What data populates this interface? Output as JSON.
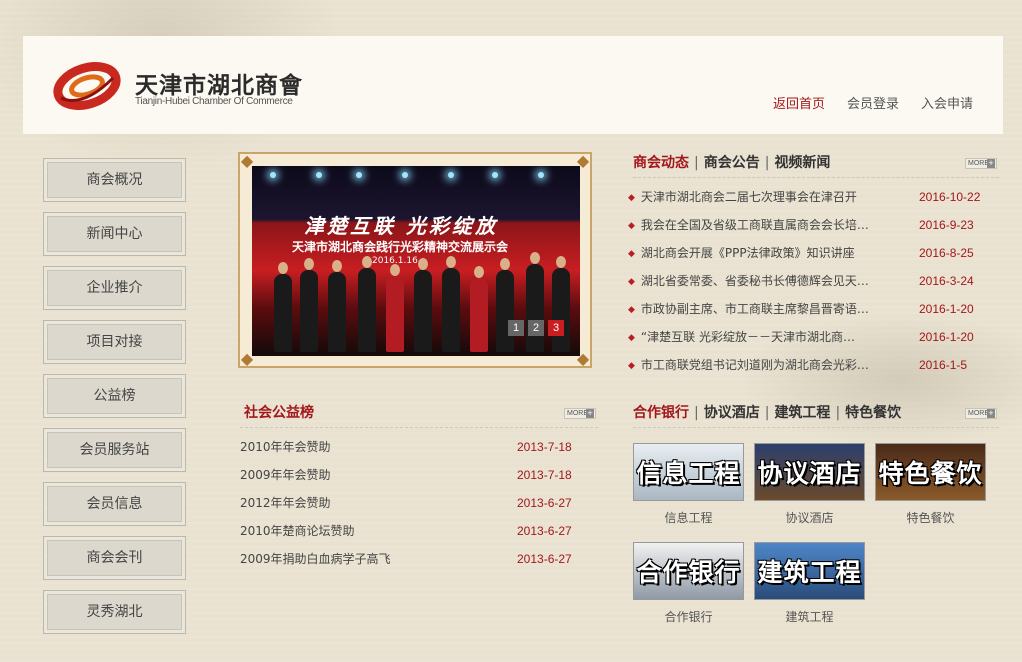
{
  "header": {
    "logo_cn": "天津市湖北商會",
    "logo_en": "Tianjin-Hubei Chamber Of Commerce",
    "nav": [
      {
        "label": "返回首页",
        "active": true
      },
      {
        "label": "会员登录",
        "active": false
      },
      {
        "label": "入会申请",
        "active": false
      }
    ]
  },
  "sidebar": {
    "items": [
      {
        "label": "商会概况"
      },
      {
        "label": "新闻中心"
      },
      {
        "label": "企业推介"
      },
      {
        "label": "项目对接"
      },
      {
        "label": "公益榜"
      },
      {
        "label": "会员服务站"
      },
      {
        "label": "会员信息"
      },
      {
        "label": "商会会刊"
      },
      {
        "label": "灵秀湖北"
      }
    ]
  },
  "slider": {
    "banner_line1": "津楚互联  光彩绽放",
    "banner_line2": "天津市湖北商会践行光彩精神交流展示会",
    "banner_line3": "2016.1.16",
    "pages": [
      "1",
      "2",
      "3"
    ],
    "active_page": "3"
  },
  "news": {
    "tabs": [
      "商会动态",
      "商会公告",
      "视频新闻"
    ],
    "more": "MORE",
    "items": [
      {
        "title": "天津市湖北商会二届七次理事会在津召开",
        "date": "2016-10-22"
      },
      {
        "title": "我会在全国及省级工商联直属商会会长培…",
        "date": "2016-9-23"
      },
      {
        "title": "湖北商会开展《PPP法律政策》知识讲座",
        "date": "2016-8-25"
      },
      {
        "title": "湖北省委常委、省委秘书长傅德辉会见天…",
        "date": "2016-3-24"
      },
      {
        "title": "市政协副主席、市工商联主席黎昌晋寄语…",
        "date": "2016-1-20"
      },
      {
        "title": "“津楚互联 光彩绽放－－天津市湖北商…",
        "date": "2016-1-20"
      },
      {
        "title": "市工商联党组书记刘道刚为湖北商会光彩…",
        "date": "2016-1-5"
      }
    ]
  },
  "welfare": {
    "title": "社会公益榜",
    "more": "MORE",
    "items": [
      {
        "title": "2010年年会赞助",
        "date": "2013-7-18"
      },
      {
        "title": "2009年年会赞助",
        "date": "2013-7-18"
      },
      {
        "title": "2012年年会赞助",
        "date": "2013-6-27"
      },
      {
        "title": "2010年楚商论坛赞助",
        "date": "2013-6-27"
      },
      {
        "title": "2009年捐助白血病学子高飞",
        "date": "2013-6-27"
      }
    ]
  },
  "coop": {
    "tabs": [
      "合作银行",
      "协议酒店",
      "建筑工程",
      "特色餐饮"
    ],
    "more": "MORE",
    "tiles": [
      {
        "image_text": "信息工程",
        "caption": "信息工程"
      },
      {
        "image_text": "协议酒店",
        "caption": "协议酒店"
      },
      {
        "image_text": "特色餐饮",
        "caption": "特色餐饮"
      },
      {
        "image_text": "合作银行",
        "caption": "合作银行"
      },
      {
        "image_text": "建筑工程",
        "caption": "建筑工程"
      }
    ]
  },
  "colors": {
    "accent_red": "#a3171c",
    "background": "#e9e2d0"
  }
}
